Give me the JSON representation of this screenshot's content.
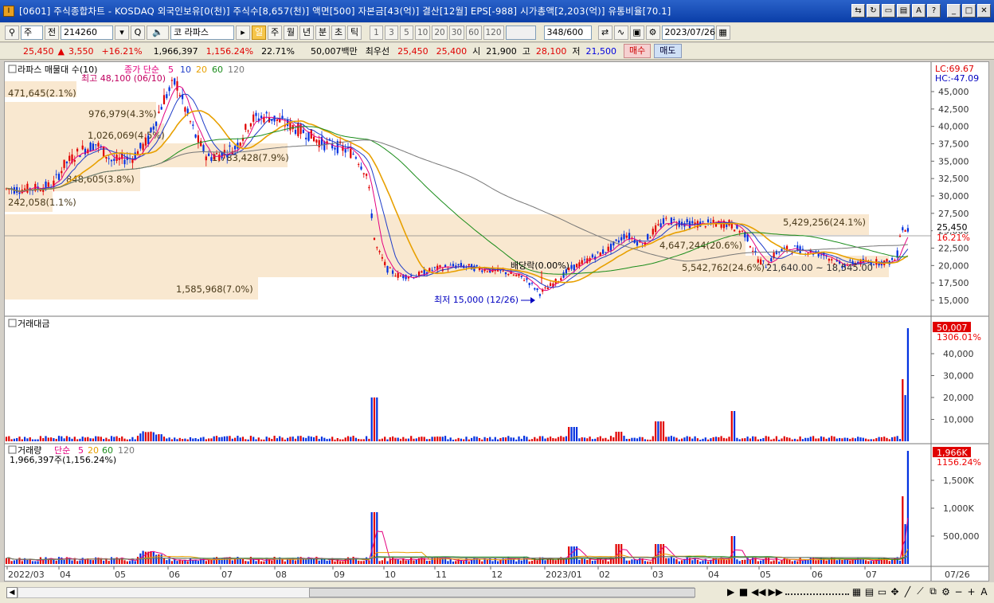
{
  "window": {
    "title": "[0601] 주식종합차트 - KOSDAQ 외국인보유[0(천)] 주식수[8,657(천)] 액면[500] 자본금[43(억)] 결산[12월] EPS[-988] 시가총액[2,203(억)] 유통비율[70.1]",
    "app_icon": "I"
  },
  "toolbar": {
    "type_select": "주",
    "prev_label": "전",
    "code": "214260",
    "stock_name": "라파스",
    "stock_prefix": "코",
    "periods": [
      "일",
      "주",
      "월",
      "년",
      "분",
      "초",
      "틱"
    ],
    "active_period": "일",
    "intervals": [
      "1",
      "3",
      "5",
      "10",
      "20",
      "30",
      "60",
      "120"
    ],
    "count": "348",
    "count_max": "/600",
    "date": "2023/07/26"
  },
  "quote": {
    "price": "25,450",
    "change": "3,550",
    "change_pct": "+16.21%",
    "volume": "1,966,397",
    "volume_ratio": "1,156.24%",
    "turnover": "22.71%",
    "amount": "50,007백만",
    "best_label": "최우선",
    "best_ask": "25,450",
    "best_bid": "25,400",
    "open_label": "시",
    "open": "21,900",
    "high_label": "고",
    "high": "28,100",
    "low_label": "저",
    "low": "21,500",
    "buy_label": "매수",
    "sell_label": "매도"
  },
  "price_panel": {
    "legend_title": "라파스 매물대 수(10)",
    "ma_label": "종가 단순",
    "ma_periods": [
      "5",
      "10",
      "20",
      "60",
      "120"
    ],
    "ma_colors": [
      "#e4007f",
      "#1e3cc8",
      "#e8a000",
      "#1a8c1a",
      "#777777"
    ],
    "high_note": "최고 48,100 (06/10)",
    "low_note": "최저 15,000 (12/26)",
    "dividend_note": "배당락(0.00%)",
    "range_note": "21,640.00 ~ 18,545.00",
    "lc": "LC:69.67",
    "hc": "HC:-47.09",
    "current_price_tag": "25,450",
    "current_pct_tag": "16.21%",
    "y_ticks": [
      "45,000",
      "42,500",
      "40,000",
      "37,500",
      "35,000",
      "32,500",
      "30,000",
      "27,500",
      "25,000",
      "22,500",
      "20,000",
      "17,500",
      "15,000"
    ],
    "volume_profile_labels": [
      "471,645(2.1%)",
      "976,979(4.3%)",
      "1,026,069(4.5%)",
      "1,783,428(7.9%)",
      "848,605(3.8%)",
      "242,058(1.1%)",
      "5,429,256(24.1%)",
      "4,647,244(20.6%)",
      "5,542,762(24.6%)",
      "1,585,968(7.0%)"
    ]
  },
  "amount_panel": {
    "title": "거래대금",
    "value_tag": "50,007",
    "pct_tag": "1306.01%",
    "y_ticks": [
      "40,000",
      "30,000",
      "20,000",
      "10,000"
    ]
  },
  "volume_panel": {
    "title": "거래량",
    "ma_label": "단순",
    "ma_periods": [
      "5",
      "20",
      "60",
      "120"
    ],
    "value_line": "1,966,397주(1,156.24%)",
    "value_tag": "1,966K",
    "pct_tag": "1156.24%",
    "y_ticks": [
      "1,500K",
      "1,000K",
      "500,000"
    ]
  },
  "x_axis": {
    "labels": [
      "2022/03",
      "04",
      "05",
      "06",
      "07",
      "08",
      "09",
      "10",
      "11",
      "12",
      "2023/01",
      "02",
      "03",
      "04",
      "05",
      "06",
      "07"
    ],
    "end_label": "07/26"
  },
  "status": {
    "controls": [
      "▶",
      "■",
      "◀◀",
      "▶▶"
    ],
    "tools": [
      "−",
      "+",
      "A"
    ]
  }
}
